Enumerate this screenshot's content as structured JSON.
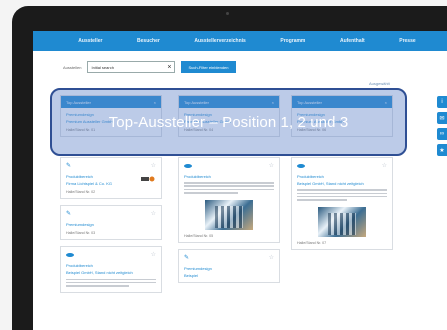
{
  "nav": [
    "Aussteller",
    "Besucher",
    "Ausstellerverzeichnis",
    "Programm",
    "Aufenthalt",
    "Presse"
  ],
  "search": {
    "label": "Ausstellen",
    "value": "Initial search",
    "button": "Such-Filter einblenden"
  },
  "link_right": "Ausgewählt",
  "columns": [
    {
      "head": "Top Aussteller",
      "cards": [
        {
          "cat": "Premiumdesign",
          "company": "Premium Aussteller GmbH",
          "meta": "Halle/Stand Nr. 01"
        },
        {
          "cat": "Produktbereich",
          "company": "Firma Lichtspiel & Co. KG",
          "meta": "Halle/Stand Nr. 02"
        },
        {
          "cat": "Premiumdesign",
          "company": "",
          "meta": "Halle/Stand Nr. 03"
        },
        {
          "cat": "Produktbereich",
          "company": "Beispiel GmbH, Stand nicht zeitgleich",
          "meta": ""
        }
      ]
    },
    {
      "head": "Top Aussteller",
      "cards": [
        {
          "cat": "Premiumdesign",
          "company": "Premium Aussteller GmbH",
          "meta": "Halle/Stand Nr. 04"
        },
        {
          "cat": "Produktbereich",
          "company": "",
          "meta": "Halle/Stand Nr. 05"
        },
        {
          "cat": "Premiumdesign",
          "company": "Beispiel",
          "meta": ""
        }
      ]
    },
    {
      "head": "Top Aussteller",
      "cards": [
        {
          "cat": "Premiumdesign",
          "company": "Premium Aussteller GmbH",
          "meta": "Halle/Stand Nr. 06"
        },
        {
          "cat": "Produktbereich",
          "company": "Beispiel GmbH, Stand nicht zeitgleich",
          "meta": "Halle/Stand Nr. 07"
        }
      ]
    }
  ],
  "overlay": "Top-Aussteller – Position 1, 2 und 3",
  "side_icons": [
    "info-icon",
    "mail-icon",
    "link-icon",
    "star-icon"
  ],
  "colors": {
    "accent": "#1f8ad1",
    "overlay": "#5f82c8",
    "overlay_border": "#2f4f94"
  }
}
